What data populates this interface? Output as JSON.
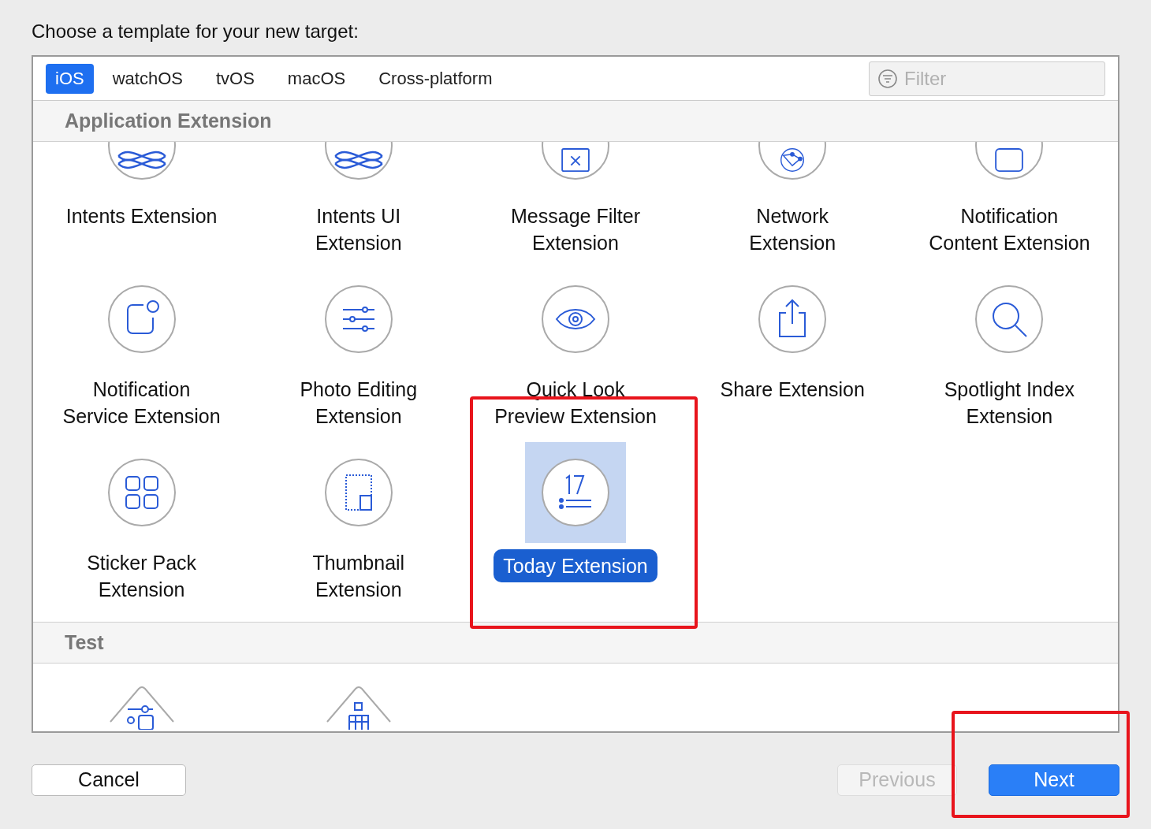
{
  "heading": "Choose a template for your new target:",
  "tabs": [
    {
      "label": "iOS",
      "selected": true
    },
    {
      "label": "watchOS",
      "selected": false
    },
    {
      "label": "tvOS",
      "selected": false
    },
    {
      "label": "macOS",
      "selected": false
    },
    {
      "label": "Cross-platform",
      "selected": false
    }
  ],
  "filter": {
    "placeholder": "Filter"
  },
  "sections": [
    {
      "title": "Application Extension",
      "items": [
        {
          "label": "Intents Extension",
          "selected": false
        },
        {
          "label": "Intents UI\nExtension",
          "selected": false
        },
        {
          "label": "Message Filter\nExtension",
          "selected": false
        },
        {
          "label": "Network\nExtension",
          "selected": false
        },
        {
          "label": "Notification\nContent Extension",
          "selected": false
        },
        {
          "label": "Notification\nService Extension",
          "selected": false
        },
        {
          "label": "Photo Editing\nExtension",
          "selected": false
        },
        {
          "label": "Quick Look\nPreview Extension",
          "selected": false
        },
        {
          "label": "Share Extension",
          "selected": false
        },
        {
          "label": "Spotlight Index\nExtension",
          "selected": false
        },
        {
          "label": "Sticker Pack\nExtension",
          "selected": false
        },
        {
          "label": "Thumbnail\nExtension",
          "selected": false
        },
        {
          "label": "Today Extension",
          "selected": true
        }
      ]
    },
    {
      "title": "Test"
    }
  ],
  "buttons": [
    {
      "label": "Cancel",
      "kind": "normal",
      "disabled": false
    },
    {
      "label": "Previous",
      "kind": "normal",
      "disabled": true
    },
    {
      "label": "Next",
      "kind": "default",
      "disabled": false
    }
  ]
}
